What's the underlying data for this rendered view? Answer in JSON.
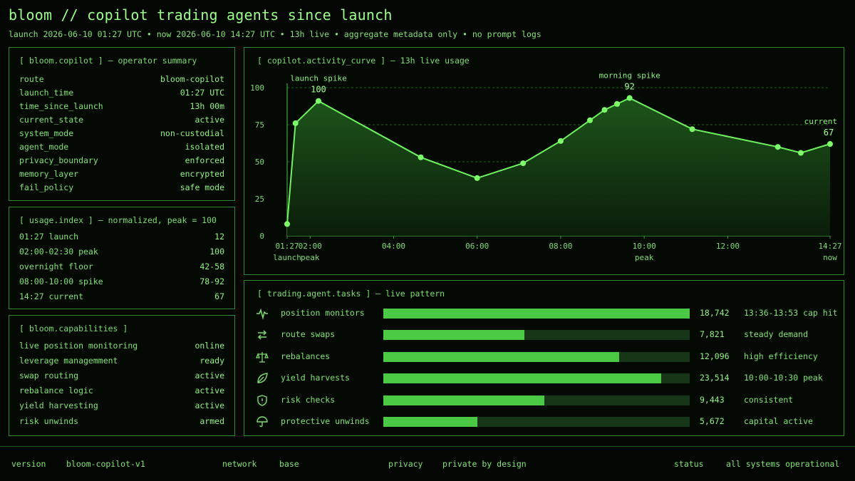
{
  "header": {
    "title": "bloom // copilot trading agents since launch",
    "subtitle": "launch 2026-06-10 01:27 UTC • now 2026-06-10 14:27 UTC • 13h live • aggregate metadata only • no prompt logs"
  },
  "summary": {
    "title": "[ bloom.copilot ] — operator summary",
    "rows": [
      {
        "k": "route",
        "v": "bloom-copilot"
      },
      {
        "k": "launch_time",
        "v": "01:27 UTC"
      },
      {
        "k": "time_since_launch",
        "v": "13h 00m"
      },
      {
        "k": "current_state",
        "v": "active"
      },
      {
        "k": "system_mode",
        "v": "non-custodial"
      },
      {
        "k": "agent_mode",
        "v": "isolated"
      },
      {
        "k": "privacy_boundary",
        "v": "enforced"
      },
      {
        "k": "memory_layer",
        "v": "encrypted"
      },
      {
        "k": "fail_policy",
        "v": "safe mode"
      }
    ]
  },
  "usage": {
    "title": "[ usage.index ] — normalized, peak = 100",
    "rows": [
      {
        "k": "01:27 launch",
        "v": "12"
      },
      {
        "k": "02:00-02:30 peak",
        "v": "100"
      },
      {
        "k": "overnight floor",
        "v": "42-58"
      },
      {
        "k": "08:00-10:00 spike",
        "v": "78-92"
      },
      {
        "k": "14:27 current",
        "v": "67"
      }
    ]
  },
  "capabilities": {
    "title": "[ bloom.capabilities ]",
    "rows": [
      {
        "k": "live position monitoring",
        "v": "online"
      },
      {
        "k": "leverage managemment",
        "v": "ready"
      },
      {
        "k": "swap routing",
        "v": "active"
      },
      {
        "k": "rebalance logic",
        "v": "active"
      },
      {
        "k": "yield harvesting",
        "v": "active"
      },
      {
        "k": "risk unwinds",
        "v": "armed"
      }
    ]
  },
  "activity": {
    "title": "[ copilot.activity_curve ] — 13h live usage"
  },
  "chart_data": {
    "type": "area",
    "title": "[ copilot.activity_curve ] — 13h live usage",
    "x_unit": "hours since 00:00 UTC",
    "xlim": [
      1.45,
      14.45
    ],
    "ylim": [
      0,
      100
    ],
    "yticks": [
      0,
      25,
      50,
      75,
      100
    ],
    "grid": "horizontal dashed",
    "x_ticks": [
      {
        "x": 1.45,
        "label": "01:27",
        "sub": "launch"
      },
      {
        "x": 2.0,
        "label": "02:00",
        "sub": "peak"
      },
      {
        "x": 4.0,
        "label": "04:00",
        "sub": ""
      },
      {
        "x": 6.0,
        "label": "06:00",
        "sub": ""
      },
      {
        "x": 8.0,
        "label": "08:00",
        "sub": ""
      },
      {
        "x": 10.0,
        "label": "10:00",
        "sub": "peak"
      },
      {
        "x": 12.0,
        "label": "12:00",
        "sub": ""
      },
      {
        "x": 14.45,
        "label": "14:27",
        "sub": "now"
      }
    ],
    "points": [
      {
        "x": 1.45,
        "y": 8
      },
      {
        "x": 1.65,
        "y": 76
      },
      {
        "x": 2.2,
        "y": 91
      },
      {
        "x": 4.65,
        "y": 53
      },
      {
        "x": 6.0,
        "y": 39
      },
      {
        "x": 7.1,
        "y": 49
      },
      {
        "x": 8.0,
        "y": 64
      },
      {
        "x": 8.7,
        "y": 78
      },
      {
        "x": 9.05,
        "y": 85
      },
      {
        "x": 9.35,
        "y": 89
      },
      {
        "x": 9.65,
        "y": 93
      },
      {
        "x": 11.15,
        "y": 72
      },
      {
        "x": 13.2,
        "y": 60
      },
      {
        "x": 13.75,
        "y": 56
      },
      {
        "x": 14.45,
        "y": 62
      }
    ],
    "annotations": [
      {
        "x": 2.2,
        "label": "launch spike",
        "value": "100"
      },
      {
        "x": 9.65,
        "label": "morning spike",
        "value": "92"
      },
      {
        "x": 14.45,
        "label": "current",
        "value": "67"
      }
    ],
    "line_color": "#6ff25f",
    "fill_color": "#1f5a1c"
  },
  "tasks": {
    "title": "[ trading.agent.tasks ] — live pattern",
    "rows": [
      {
        "icon": "pulse-icon",
        "label": "position monitors",
        "count": "18,742",
        "fraction": 1.0,
        "note": "13:36-13:53 cap hit"
      },
      {
        "icon": "swap-arrows-icon",
        "label": "route swaps",
        "count": "7,821",
        "fraction": 0.46,
        "note": "steady demand"
      },
      {
        "icon": "scale-icon",
        "label": "rebalances",
        "count": "12,096",
        "fraction": 0.77,
        "note": "high efficiency"
      },
      {
        "icon": "leaf-icon",
        "label": "yield harvests",
        "count": "23,514",
        "fraction": 0.906,
        "note": "10:00-10:30 peak"
      },
      {
        "icon": "shield-icon",
        "label": "risk checks",
        "count": "9,443",
        "fraction": 0.525,
        "note": "consistent"
      },
      {
        "icon": "umbrella-icon",
        "label": "protective unwinds",
        "count": "5,672",
        "fraction": 0.307,
        "note": "capital active"
      }
    ],
    "bar_color": "#4cc944",
    "track_color": "#173517"
  },
  "footer": {
    "version_label": "version",
    "version_value": "bloom-copilot-v1",
    "network_label": "network",
    "network_value": "base",
    "privacy_label": "privacy",
    "privacy_value": "private by design",
    "status_label": "status",
    "status_value": "all systems operational"
  }
}
